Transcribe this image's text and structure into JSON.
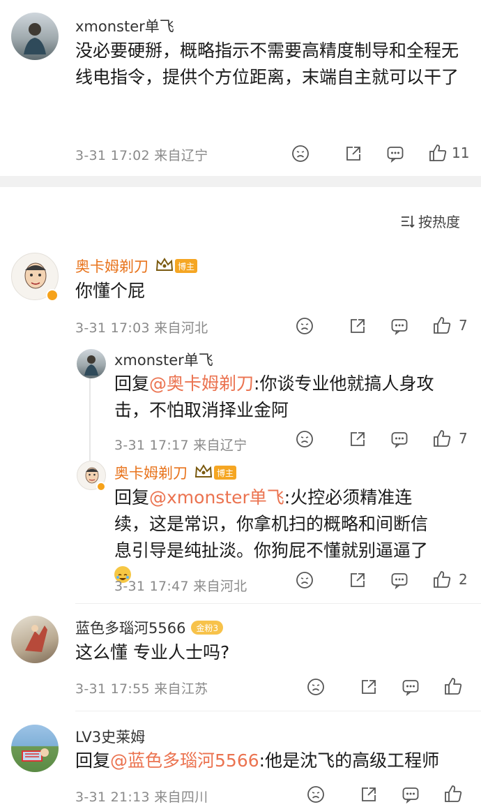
{
  "post": {
    "author": "xmonster单飞",
    "text": "没必要硬掰，概略指示不需要高精度制导和全程无线电指令，提供个方位距离，末端自主就可以干了",
    "meta": "3-31 17:02  来自辽宁",
    "likes": "11"
  },
  "sort": {
    "label": "按热度"
  },
  "comments": [
    {
      "author": "奥卡姆剃刀",
      "badge": "博主",
      "text": "你懂个屁",
      "meta": "3-31 17:03  来自河北",
      "likes": "7"
    },
    {
      "author": "xmonster单飞",
      "reply_prefix": "回复",
      "mention": "@奥卡姆剃刀",
      "text": ":你谈专业他就搞人身攻击，不怕取消择业金阿",
      "meta": "3-31 17:17  来自辽宁",
      "likes": "7"
    },
    {
      "author": "奥卡姆剃刀",
      "badge": "博主",
      "reply_prefix": "回复",
      "mention": "@xmonster单飞",
      "text": ":火控必须精准连续，这是常识，你拿机扫的概略和间断信息引导是纯扯淡。你狗屁不懂就别逼逼了",
      "meta": "3-31 17:47  来自河北",
      "likes": "2"
    },
    {
      "author": "蓝色多瑙河5566",
      "badge": "金粉3",
      "text": "这么懂 专业人士吗?",
      "meta": "3-31 17:55  来自江苏",
      "likes": ""
    },
    {
      "author": "LV3史莱姆",
      "reply_prefix": "回复",
      "mention": "@蓝色多瑙河5566",
      "text": ":他是沈飞的高级工程师",
      "meta": "3-31 21:13  来自四川",
      "likes": ""
    }
  ],
  "icons": [
    "avatar",
    "dislike-icon",
    "share-icon",
    "comment-icon",
    "like-icon",
    "crown-icon",
    "sort-icon",
    "laugh-cry-emoji"
  ],
  "colors": {
    "accent": "#eb7350",
    "name_vip": "#e8741d",
    "badge": "#f5a623",
    "meta": "#8a8a8a"
  }
}
